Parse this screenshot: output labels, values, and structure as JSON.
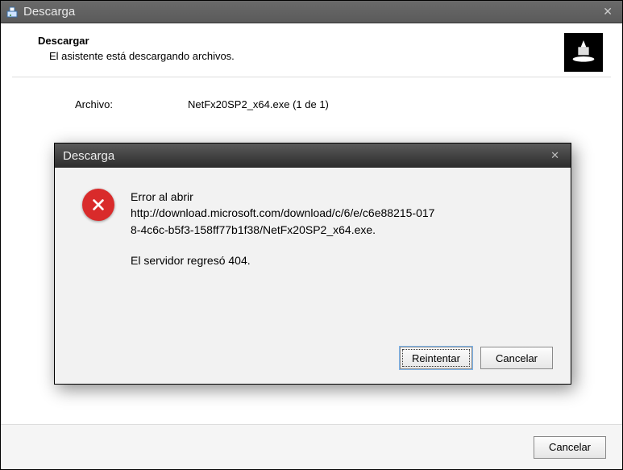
{
  "outer": {
    "title": "Descarga",
    "header_title": "Descargar",
    "header_sub": "El asistente está descargando archivos.",
    "file_label": "Archivo:",
    "file_value": "NetFx20SP2_x64.exe (1 de 1)",
    "cancel_label": "Cancelar"
  },
  "dialog": {
    "title": "Descarga",
    "error_line1": "Error al abrir",
    "error_line2": "http://download.microsoft.com/download/c/6/e/c6e88215-017",
    "error_line3": "8-4c6c-b5f3-158ff77b1f38/NetFx20SP2_x64.exe.",
    "error_line4": "El servidor regresó 404.",
    "retry_label": "Reintentar",
    "cancel_label": "Cancelar"
  }
}
